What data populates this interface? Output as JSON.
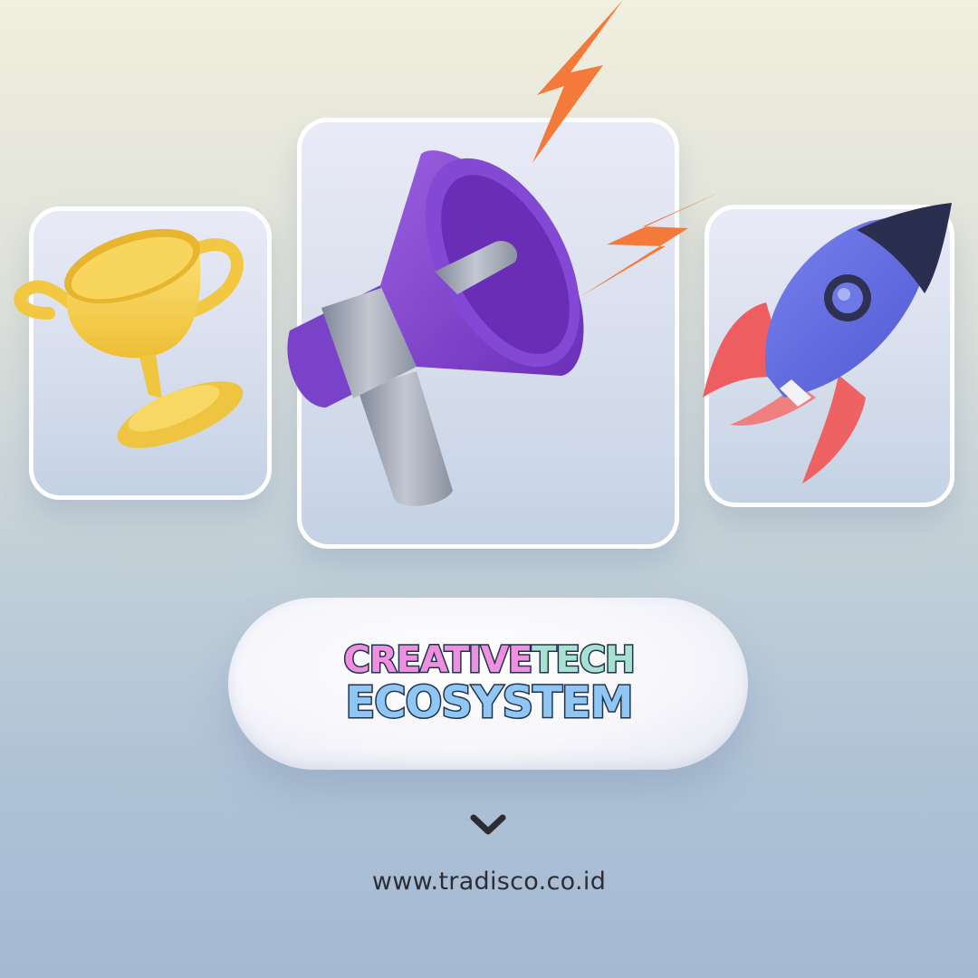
{
  "headline": {
    "word1": "CREATIVE",
    "word2": "TECH",
    "line2": "ECOSYSTEM"
  },
  "website": "www.tradisco.co.id",
  "icons": {
    "left": "trophy-icon",
    "center": "megaphone-icon",
    "right": "rocket-icon",
    "down": "chevron-down-icon"
  },
  "colors": {
    "headline_pink": "#f08fe0",
    "headline_mint": "#a6e2cf",
    "headline_blue": "#8fc6f3",
    "headline_outline": "#1f3350",
    "bolt_orange": "#f47a3a"
  }
}
